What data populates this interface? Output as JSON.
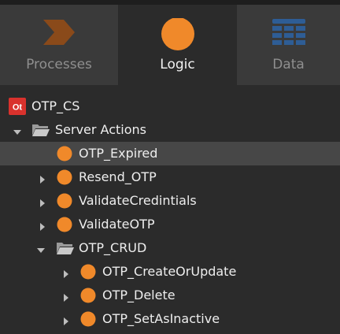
{
  "tabs": [
    {
      "label": "Processes",
      "active": false,
      "icon": "processes-chevron-icon",
      "color": "#8a4a1a"
    },
    {
      "label": "Logic",
      "active": true,
      "icon": "logic-circle-icon",
      "color": "#f0892a"
    },
    {
      "label": "Data",
      "active": false,
      "icon": "data-grid-icon",
      "color": "#2e5d95"
    }
  ],
  "tree": {
    "module": {
      "label": "OTP_CS",
      "badge": "Ot",
      "badge_color": "#d9322d"
    },
    "server_actions": {
      "label": "Server Actions",
      "expanded": true
    },
    "items": [
      {
        "label": "OTP_Expired",
        "selected": true,
        "has_children": false
      },
      {
        "label": "Resend_OTP",
        "selected": false,
        "has_children": true
      },
      {
        "label": "ValidateCredintials",
        "selected": false,
        "has_children": true
      },
      {
        "label": "ValidateOTP",
        "selected": false,
        "has_children": true
      }
    ],
    "folder": {
      "label": "OTP_CRUD",
      "expanded": true,
      "items": [
        {
          "label": "OTP_CreateOrUpdate",
          "has_children": true
        },
        {
          "label": "OTP_Delete",
          "has_children": true
        },
        {
          "label": "OTP_SetAsInactive",
          "has_children": true
        }
      ]
    },
    "action_color": "#f0892a"
  }
}
